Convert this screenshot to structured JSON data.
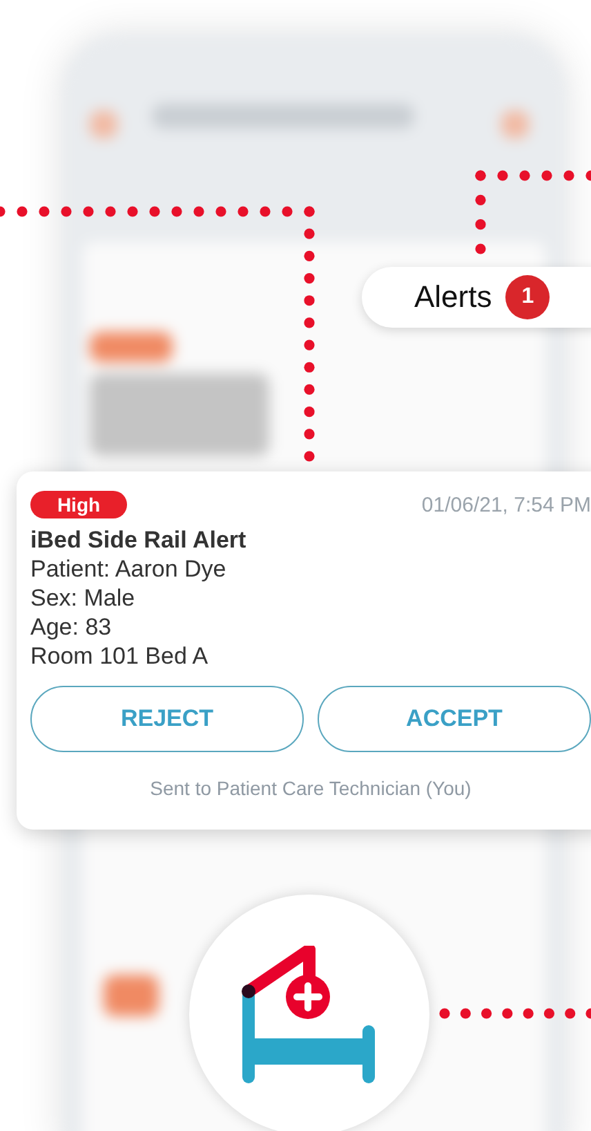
{
  "alerts_chip": {
    "label": "Alerts",
    "count": "1"
  },
  "alert_card": {
    "priority": "High",
    "timestamp": "01/06/21, 7:54 PM",
    "title": "iBed Side Rail Alert",
    "details": [
      "Patient: Aaron Dye",
      "Sex: Male",
      "Age: 83",
      "Room 101 Bed A"
    ],
    "buttons": [
      {
        "label": "REJECT"
      },
      {
        "label": "ACCEPT"
      }
    ],
    "footer": "Sent to Patient Care Technician (You)"
  }
}
